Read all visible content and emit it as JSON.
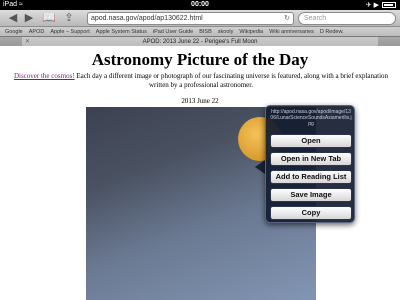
{
  "status": {
    "carrier": "iPad",
    "wifi": "≈",
    "time": "00:00",
    "right_icons": "✈ ▶"
  },
  "nav": {
    "back": "◀",
    "forward": "▶",
    "bookmarks": "📖",
    "share": "⇪",
    "url": "apod.nasa.gov/apod/ap130622.html",
    "reload": "↻",
    "search_placeholder": "Search"
  },
  "bookmarks": [
    "Google",
    "APOD",
    "Apple – Support",
    "Apple System Status",
    "iPad User Guide",
    "BISB",
    "skooly",
    "Wikipedia",
    "Wiki anniversaries",
    "D Redew."
  ],
  "tab": {
    "close": "✕",
    "title": "APOD: 2013 June 22 - Perigee's Full Moon"
  },
  "page": {
    "title": "Astronomy Picture of the Day",
    "intro_link": "Discover the cosmos!",
    "intro_text": " Each day a different image or photograph of our fascinating universe is featured, along with a brief explanation written by a professional astronomer.",
    "date": "2013 June 22"
  },
  "popup": {
    "url": "http://apod.nasa.gov/apod/image/1306/LunarScienceSoundsAsiamerilis.jpg",
    "items": [
      "Open",
      "Open in New Tab",
      "Add to Reading List",
      "Save Image",
      "Copy"
    ]
  }
}
